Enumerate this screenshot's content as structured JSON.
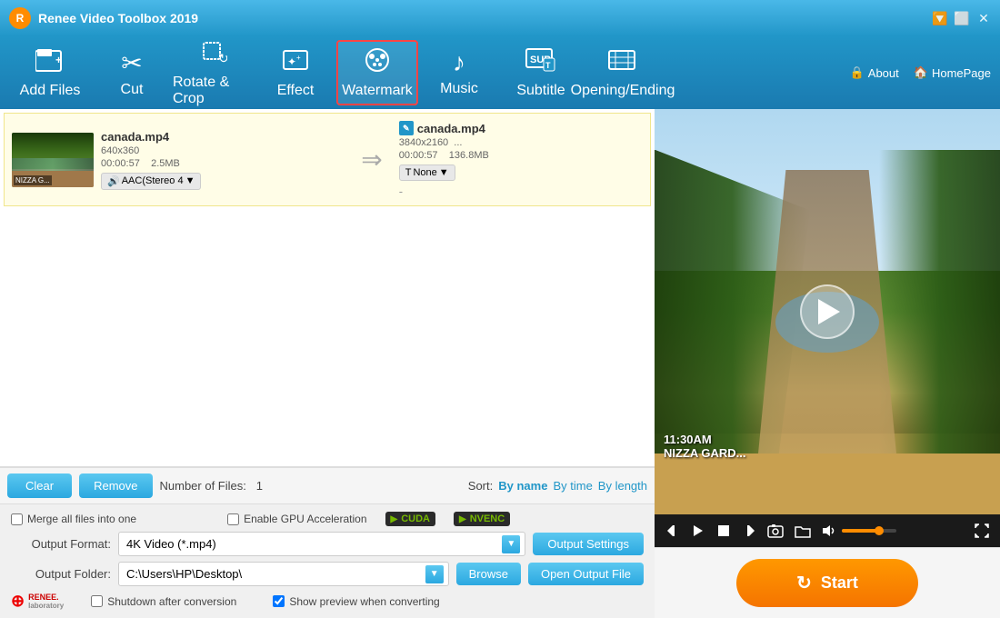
{
  "titleBar": {
    "title": "Renee Video Toolbox 2019",
    "controls": [
      "minimize",
      "maximize",
      "close"
    ]
  },
  "toolbar": {
    "items": [
      {
        "id": "add-files",
        "label": "Add Files",
        "icon": "🎬"
      },
      {
        "id": "cut",
        "label": "Cut",
        "icon": "✂"
      },
      {
        "id": "rotate-crop",
        "label": "Rotate & Crop",
        "icon": "⟳"
      },
      {
        "id": "effect",
        "label": "Effect",
        "icon": "✨"
      },
      {
        "id": "watermark",
        "label": "Watermark",
        "icon": "🎞",
        "active": true
      },
      {
        "id": "music",
        "label": "Music",
        "icon": "♪"
      },
      {
        "id": "subtitle",
        "label": "Subtitle",
        "icon": "SUB"
      },
      {
        "id": "opening-ending",
        "label": "Opening/Ending",
        "icon": "▦"
      }
    ],
    "about": "About",
    "homepage": "HomePage"
  },
  "fileList": {
    "files": [
      {
        "name": "canada.mp4",
        "resolution": "640x360",
        "duration": "00:00:57",
        "size": "2.5MB",
        "audio": "AAC(Stereo 4",
        "textTrack": "None",
        "outputName": "canada.mp4",
        "outputResolution": "3840x2160",
        "outputDuration": "00:00:57",
        "outputSize": "136.8MB",
        "outputText": "-"
      }
    ]
  },
  "bottomBar": {
    "clearLabel": "Clear",
    "removeLabel": "Remove",
    "fileCountLabel": "Number of Files:",
    "fileCount": "1",
    "sortLabel": "Sort:",
    "sortByName": "By name",
    "sortByTime": "By time",
    "sortByLength": "By length"
  },
  "settings": {
    "mergeLabel": "Merge all files into one",
    "gpuLabel": "Enable GPU Acceleration",
    "cudaLabel": "CUDA",
    "nvencLabel": "NVENC",
    "outputFormatLabel": "Output Format:",
    "outputFormatValue": "4K Video (*.mp4)",
    "outputSettingsLabel": "Output Settings",
    "outputFolderLabel": "Output Folder:",
    "outputFolderValue": "C:\\Users\\HP\\Desktop\\",
    "browseLabel": "Browse",
    "openOutputLabel": "Open Output File",
    "shutdownLabel": "Shutdown after conversion",
    "showPreviewLabel": "Show preview when converting"
  },
  "videoPreview": {
    "overlayTime": "11:30AM",
    "overlayText": "NIZZA GARD..."
  },
  "startButton": {
    "label": "Start"
  }
}
